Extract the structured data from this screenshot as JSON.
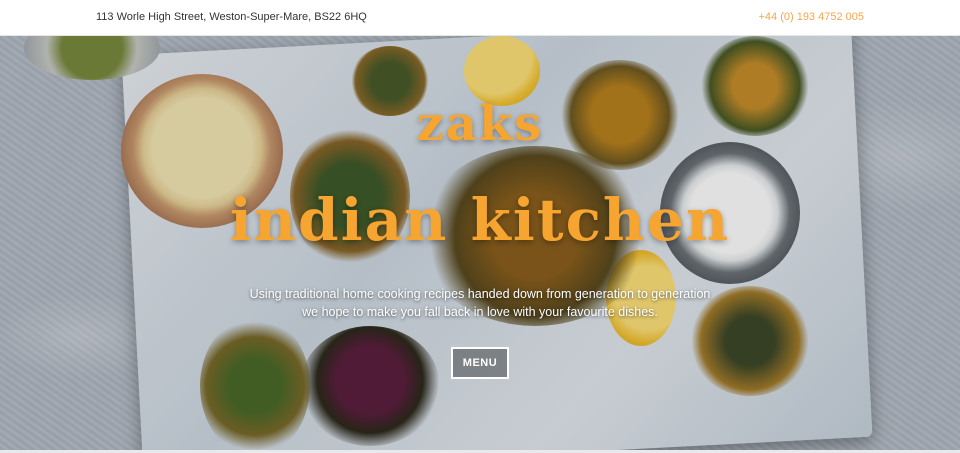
{
  "topbar": {
    "address": "113 Worle High Street, Weston-Super-Mare, BS22 6HQ",
    "phone": "+44 (0) 193 4752 005"
  },
  "hero": {
    "title_line1": "zaks",
    "title_line2": "indian kitchen",
    "tagline_line1": "Using traditional home cooking recipes handed down from generation to generation",
    "tagline_line2": "we hope to make you fall back in love with your favourite dishes.",
    "menu_button": "MENU",
    "background_image": "fried-vegetables-on-board-photo"
  },
  "colors": {
    "brand": "#f6a531",
    "phone": "#f5a64a"
  }
}
